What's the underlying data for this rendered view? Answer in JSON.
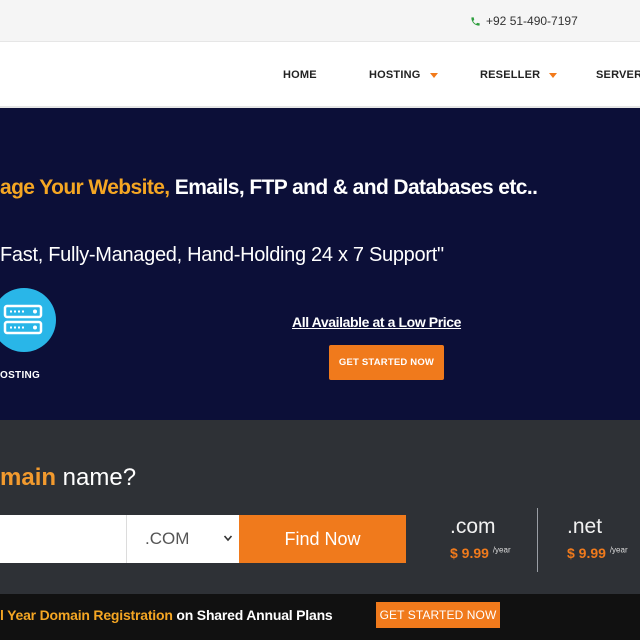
{
  "topbar": {
    "phone_icon": "phone-icon",
    "phone_number": "+92 51-490-7197"
  },
  "nav": {
    "items": [
      {
        "label": "HOME",
        "has_dropdown": false
      },
      {
        "label": "HOSTING",
        "has_dropdown": true
      },
      {
        "label": "RESELLER",
        "has_dropdown": true
      },
      {
        "label": "SERVER",
        "has_dropdown": false
      }
    ]
  },
  "hero": {
    "headline_part1": "age  Your Website,",
    "headline_part2": "Emails,  FTP and  & and Databases etc..",
    "subline": "Fast,  Fully-Managed,  Hand-Holding 24 x 7 Support\"",
    "badge_icon": "server-icon",
    "badge_label": "OSTING",
    "availability_text": "All Available at a Low Price",
    "cta_label": "GET STARTED NOW"
  },
  "domain": {
    "title_highlight": "main",
    "title_rest": " name?",
    "input_value": "",
    "tld_selected": ".COM",
    "find_label": "Find Now",
    "prices": [
      {
        "ext": ".com",
        "price": "$ 9.99",
        "period": "/year"
      },
      {
        "ext": ".net",
        "price": "$ 9.99",
        "period": "/year"
      }
    ]
  },
  "promo": {
    "highlight": "l Year Domain Registration",
    "rest": " on Shared Annual Plans",
    "cta_label": "GET STARTED NOW"
  },
  "colors": {
    "accent": "#f07a1c",
    "hero_bg": "#0c0f38",
    "domain_bg": "#2e3136"
  }
}
